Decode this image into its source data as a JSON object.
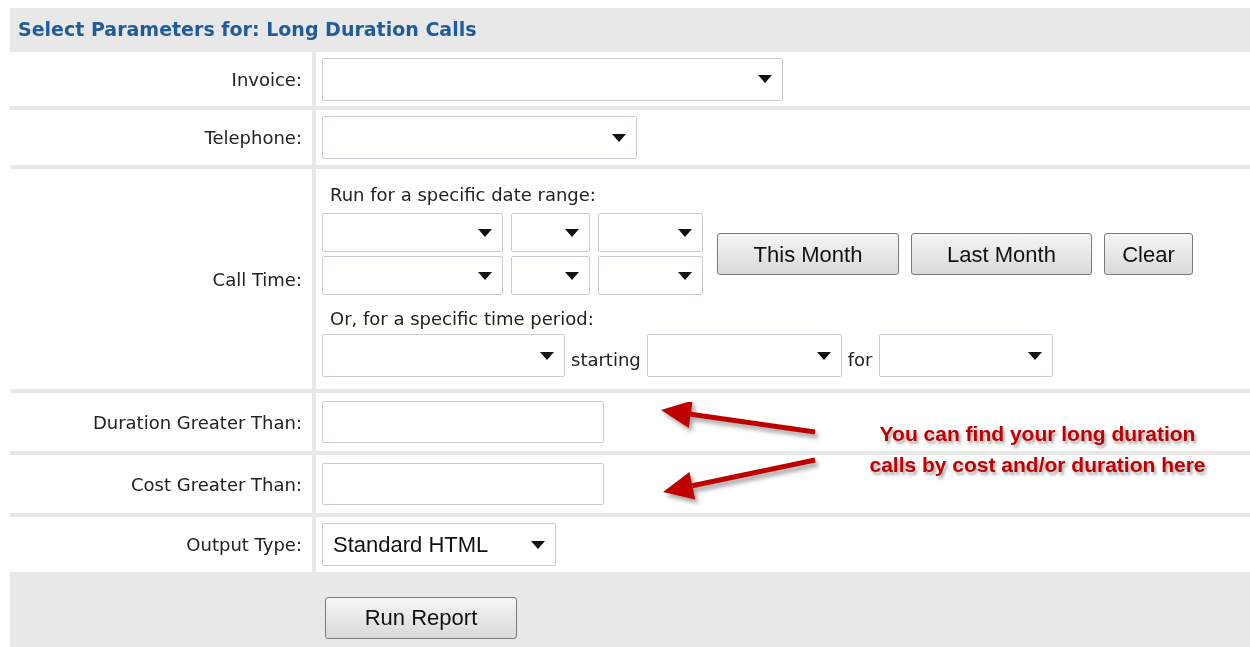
{
  "header": {
    "title": "Select Parameters for: Long Duration Calls"
  },
  "rows": [
    {
      "kind": "select",
      "label": "Invoice:"
    },
    {
      "kind": "select",
      "label": "Telephone:"
    },
    {
      "kind": "date_range",
      "label": "Call Time:",
      "range_label": "Run for a specific date range:",
      "buttons": [
        "This Month",
        "Last Month",
        "Clear"
      ],
      "period_label": "Or, for a specific time period:",
      "connectors": [
        "starting",
        "for"
      ]
    },
    {
      "kind": "text",
      "label": "Duration Greater Than:"
    },
    {
      "kind": "text",
      "label": "Cost Greater Than:"
    },
    {
      "kind": "select",
      "label": "Output Type:",
      "value": "Standard HTML"
    }
  ],
  "footer": {
    "button": "Run Report"
  },
  "annotation": {
    "lines": [
      "You can find your long duration",
      "calls by cost and/or duration here"
    ]
  }
}
